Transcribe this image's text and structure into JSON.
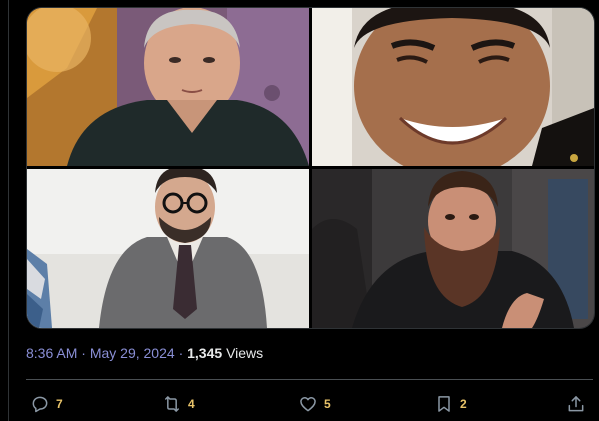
{
  "post": {
    "time": "8:36 AM",
    "separator": "·",
    "date": "May 29, 2024",
    "views_count": "1,345",
    "views_label": "Views"
  },
  "media": {
    "photos": [
      {
        "subject": "man-dark-polo-photo"
      },
      {
        "subject": "smiling-man-photo"
      },
      {
        "subject": "man-glasses-suit-photo"
      },
      {
        "subject": "bearded-man-suit-photo"
      }
    ]
  },
  "actions": {
    "reply": {
      "icon": "reply-icon",
      "count": "7"
    },
    "repost": {
      "icon": "repost-icon",
      "count": "4"
    },
    "like": {
      "icon": "heart-icon",
      "count": "5"
    },
    "bookmark": {
      "icon": "bookmark-icon",
      "count": "2"
    },
    "share": {
      "icon": "share-icon"
    }
  },
  "colors": {
    "background": "#000000",
    "meta_link": "#8a8fd6",
    "counts": "#e9c46a",
    "icons": "#8b98a5",
    "divider": "#4a4f53"
  }
}
